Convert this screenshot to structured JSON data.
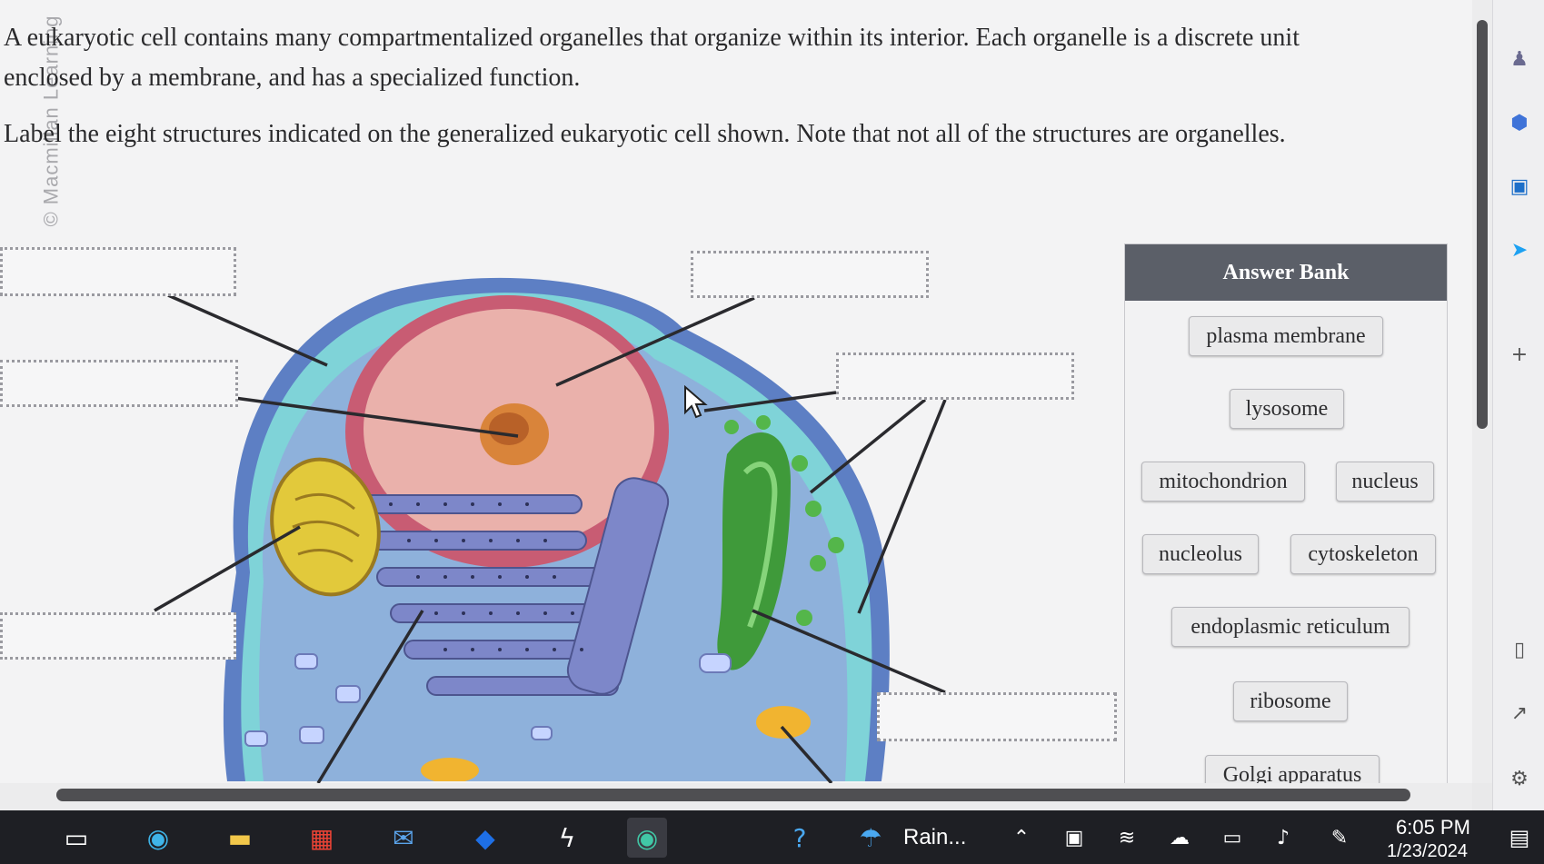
{
  "watermark": "© Macmillan Learning",
  "question": {
    "line1": "A eukaryotic cell contains many compartmentalized organelles that organize within its interior. Each organelle is a discrete unit",
    "line2": "enclosed by a membrane, and has a specialized function.",
    "line3": "Label the eight structures indicated on the generalized eukaryotic cell shown. Note that not all of the structures are organelles."
  },
  "answer_bank": {
    "title": "Answer Bank",
    "items": [
      "plasma membrane",
      "lysosome",
      "mitochondrion",
      "nucleus",
      "nucleolus",
      "cytoskeleton",
      "endoplasmic reticulum",
      "ribosome",
      "Golgi apparatus"
    ]
  },
  "taskbar": {
    "weather": "Rain...",
    "time": "6:05 PM",
    "date": "1/23/2024"
  },
  "colors": {
    "bank_header": "#5b5f68",
    "cell_cytoplasm": "#7fd3d8",
    "nucleus": "#e9a9a6",
    "nucleolus": "#d9843a",
    "er": "#8e98d6",
    "golgi": "#3f9a3a",
    "mitochondrion": "#e2c93b"
  },
  "icons": {
    "rail": [
      "user-icon",
      "copilot-icon",
      "outlook-icon",
      "send-icon",
      "add-icon"
    ],
    "taskbar": [
      "task-view-icon",
      "edge-icon",
      "file-explorer-icon",
      "store-icon",
      "mail-icon",
      "dropbox-icon",
      "app-icon",
      "edge-dev-icon",
      "help-icon",
      "weather-icon"
    ]
  }
}
